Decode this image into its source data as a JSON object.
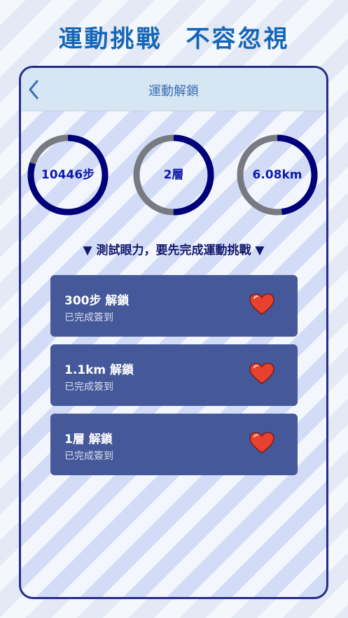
{
  "headline": {
    "left": "運動挑戰",
    "right": "不容忽視"
  },
  "nav": {
    "back_icon": "chevron-left-icon",
    "title": "運動解鎖"
  },
  "rings": [
    {
      "label": "10446步",
      "progress": 0.8
    },
    {
      "label": "2層",
      "progress": 0.5
    },
    {
      "label": "6.08km",
      "progress": 0.48
    }
  ],
  "colors": {
    "ring_progress": "#00007a",
    "ring_track": "#777a80",
    "card_bg": "#45589a",
    "heart": "#e8412f",
    "accent": "#1566b8"
  },
  "notice": "▼ 測試眼力，要先完成運動挑戰 ▼",
  "cards": [
    {
      "title": "300步 解鎖",
      "subtitle": "已完成簽到",
      "icon": "heart-icon"
    },
    {
      "title": "1.1km 解鎖",
      "subtitle": "已完成簽到",
      "icon": "heart-icon"
    },
    {
      "title": "1層 解鎖",
      "subtitle": "已完成簽到",
      "icon": "heart-icon"
    }
  ]
}
